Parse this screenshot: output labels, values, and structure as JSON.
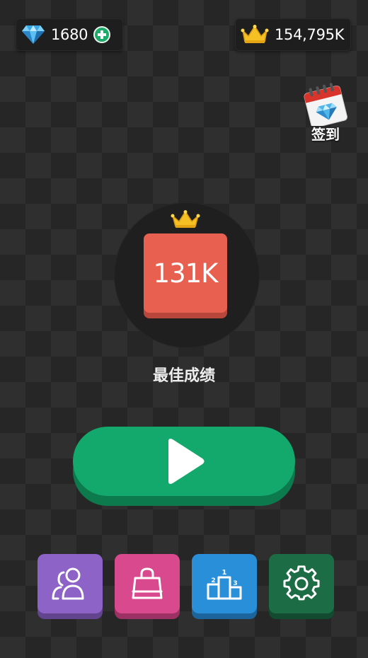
{
  "currency": {
    "gems": "1680",
    "gem_icon": "diamond-icon",
    "add_icon": "plus-circle-icon"
  },
  "crowns": {
    "total": "154,795K",
    "crown_icon": "crown-icon"
  },
  "checkin": {
    "label": "签到",
    "icon": "calendar-gem-icon"
  },
  "best": {
    "score": "131K",
    "label": "最佳成绩",
    "crown_icon": "crown-icon"
  },
  "play": {
    "icon": "play-icon"
  },
  "menu": [
    {
      "icon": "friends-icon",
      "color": "#8d63c8"
    },
    {
      "icon": "shop-bag-icon",
      "color": "#d84a8d"
    },
    {
      "icon": "leaderboard-podium-icon",
      "color": "#2a8fd9"
    },
    {
      "icon": "gear-icon",
      "color": "#1c6d45"
    }
  ],
  "colors": {
    "score_tile": "#e8604f",
    "play_green": "#14a96c",
    "plus_green": "#1faa6a",
    "crown_gold": "#f5c024"
  }
}
